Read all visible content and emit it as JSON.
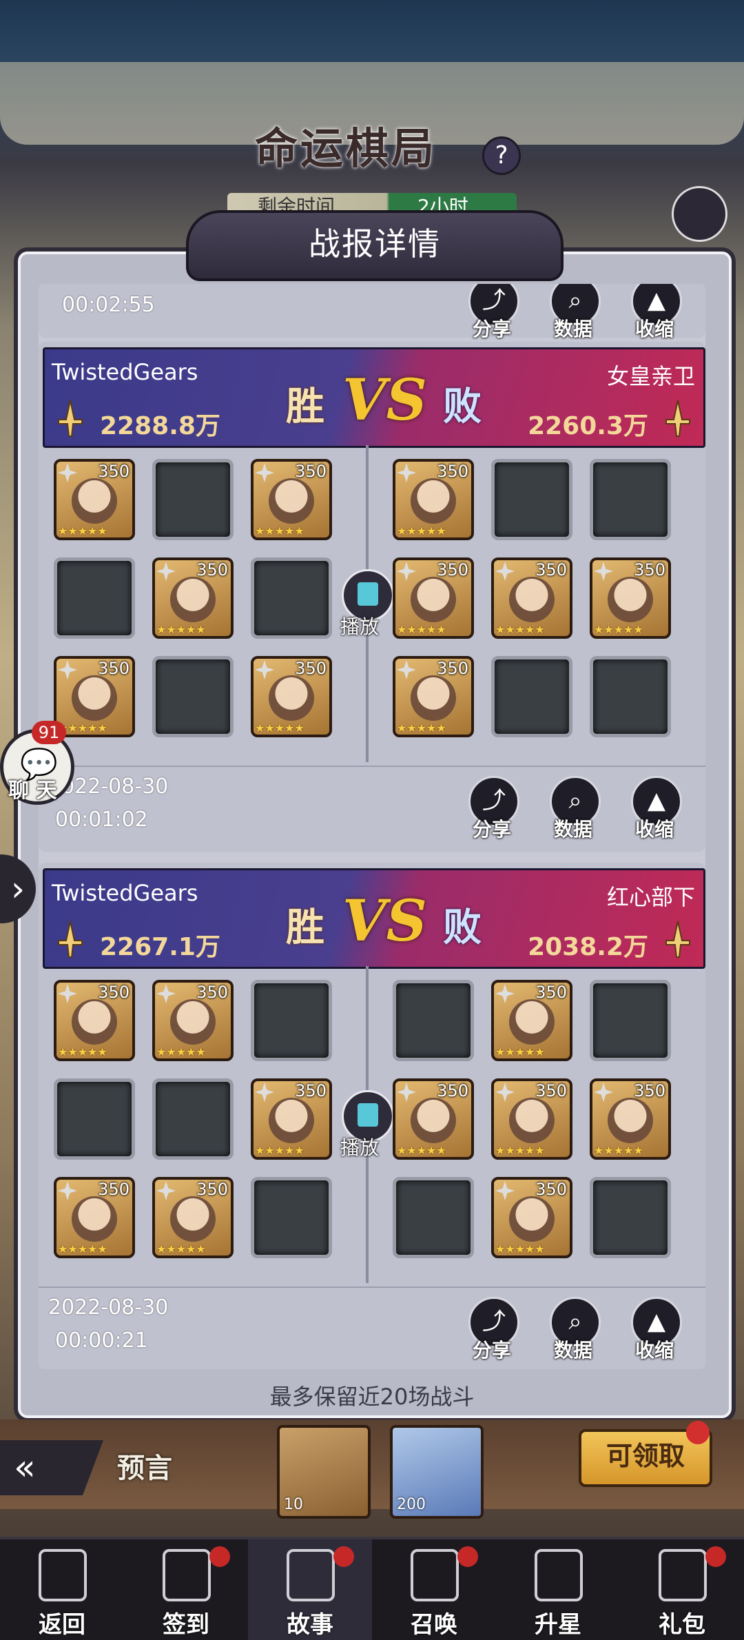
{
  "header": {
    "game_title": "命运棋局",
    "help_icon": "question-icon",
    "timer_text": "剩余时间",
    "timer_value": "2小时",
    "panel_title": "战报详情"
  },
  "top_partial": {
    "time": "00:02:55",
    "share": "分享",
    "data": "数据",
    "collapse": "收缩"
  },
  "battles": [
    {
      "left_name": "TwistedGears",
      "left_power": "2288.8万",
      "left_result": "胜",
      "vs": "VS",
      "right_result": "败",
      "right_name": "女皇亲卫",
      "right_power": "2260.3万",
      "play_label": "播放",
      "date": "2022-08-30",
      "time": "00:01:02",
      "share": "分享",
      "data": "数据",
      "collapse": "收缩",
      "left_slots": [
        "350",
        "",
        "350",
        "",
        "350",
        "",
        "350",
        "",
        "350"
      ],
      "right_slots": [
        "350",
        "",
        "",
        "350",
        "350",
        "350",
        "350",
        "",
        ""
      ]
    },
    {
      "left_name": "TwistedGears",
      "left_power": "2267.1万",
      "left_result": "胜",
      "vs": "VS",
      "right_result": "败",
      "right_name": "红心部下",
      "right_power": "2038.2万",
      "play_label": "播放",
      "date": "2022-08-30",
      "time": "00:00:21",
      "share": "分享",
      "data": "数据",
      "collapse": "收缩",
      "left_slots": [
        "350",
        "350",
        "",
        "",
        "",
        "350",
        "350",
        "350",
        ""
      ],
      "right_slots": [
        "",
        "350",
        "",
        "350",
        "350",
        "350",
        "",
        "350",
        ""
      ]
    }
  ],
  "footer_note": "最多保留近20场战斗",
  "chat": {
    "badge": "91",
    "label": "聊 天"
  },
  "lower": {
    "prophecy": "预言",
    "reward_1_count": "10",
    "reward_2_count": "200",
    "claim": "可领取"
  },
  "nav": [
    "返回",
    "签到",
    "故事",
    "召唤",
    "升星",
    "礼包"
  ],
  "colors": {
    "win_banner": "#3b3a8a",
    "lose_banner": "#c02a56",
    "vs": "#f5c531",
    "badge_red": "#c62828"
  }
}
